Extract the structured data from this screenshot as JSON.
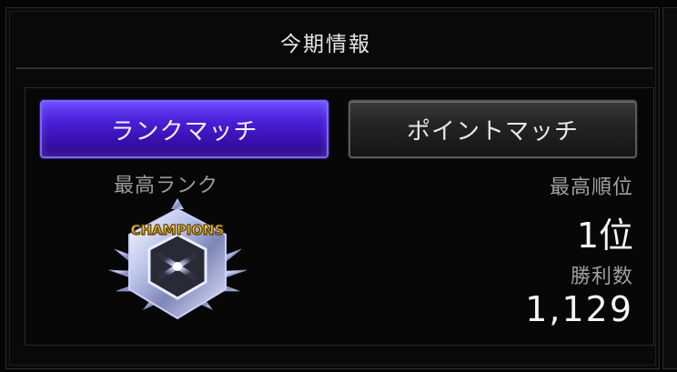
{
  "header": {
    "title": "今期情報"
  },
  "tabs": [
    {
      "label": "ランクマッチ",
      "active": true
    },
    {
      "label": "ポイントマッチ",
      "active": false
    }
  ],
  "rank": {
    "label": "最高ランク",
    "badge_text": "CHAMPIONS"
  },
  "stats": {
    "best_position_label": "最高順位",
    "best_position_value": "1位",
    "wins_label": "勝利数",
    "wins_value": "1,129"
  },
  "colors": {
    "active_tab": "#4a1fd8",
    "inactive_tab": "#242424",
    "badge_gold": "#f0c030"
  }
}
